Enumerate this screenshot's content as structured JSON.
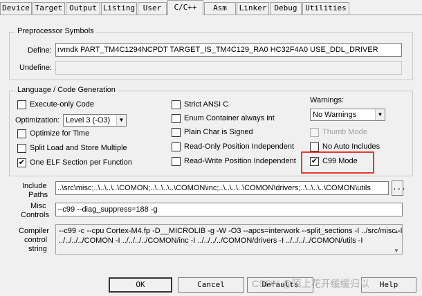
{
  "tabs": [
    "Device",
    "Target",
    "Output",
    "Listing",
    "User",
    "C/C++",
    "Asm",
    "Linker",
    "Debug",
    "Utilities"
  ],
  "preprocessor": {
    "title": "Preprocessor Symbols",
    "define_label": "Define:",
    "define_value": "rvmdk PART_TM4C1294NCPDT TARGET_IS_TM4C129_RA0 HC32F4A0 USE_DDL_DRIVER",
    "undefine_label": "Undefine:",
    "undefine_value": ""
  },
  "codegen": {
    "title": "Language / Code Generation",
    "execute_only": "Execute-only Code",
    "optimization_label": "Optimization:",
    "optimization_value": "Level 3 (-O3)",
    "optimize_time": "Optimize for Time",
    "split_load": "Split Load and Store Multiple",
    "one_elf": "One ELF Section per Function",
    "strict_ansi": "Strict ANSI C",
    "enum_container": "Enum Container always int",
    "plain_char": "Plain Char is Signed",
    "ro_pi": "Read-Only Position Independent",
    "rw_pi": "Read-Write Position Independent",
    "warnings_label": "Warnings:",
    "warnings_value": "No Warnings",
    "thumb_mode": "Thumb Mode",
    "no_auto_includes": "No Auto Includes",
    "c99_mode": "C99 Mode",
    "check_mark": "✔"
  },
  "include": {
    "label_line1": "Include",
    "label_line2": "Paths",
    "value": "..\\src\\misc;..\\..\\..\\..\\COMON;..\\..\\..\\..\\COMON\\inc;..\\..\\..\\..\\COMON\\drivers;..\\..\\..\\..\\COMON\\utils",
    "browse": "..."
  },
  "misc": {
    "label_line1": "Misc",
    "label_line2": "Controls",
    "value": "--c99 --diag_suppress=188 -g"
  },
  "compiler": {
    "label_line1": "Compiler",
    "label_line2": "control",
    "label_line3": "string",
    "line1": "--c99 -c --cpu Cortex-M4.fp -D__MICROLIB -g -W -O3 --apcs=interwork --split_sections -I ../src/misc -I",
    "line2": "../../../../COMON -I ../../../../COMON/inc -I ../../../../COMON/drivers -I ../../../../COMON/utils -I",
    "scroll_up": "▲",
    "scroll_down": "▼"
  },
  "buttons": {
    "ok": "OK",
    "cancel": "Cancel",
    "defaults": "Defaults",
    "help": "Help"
  },
  "watermark": "CSDN @陌上花开缓缓归以",
  "dropdown_arrow": "▼",
  "colors": {
    "highlight": "#e03a2f"
  }
}
